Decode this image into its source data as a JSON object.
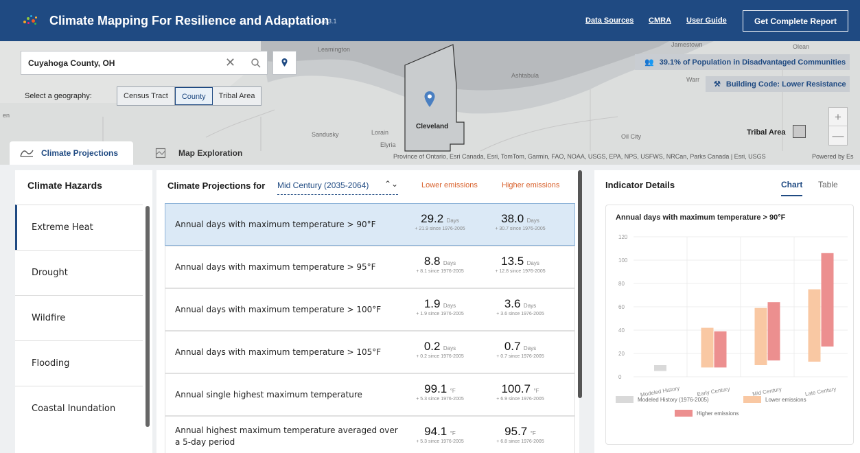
{
  "header": {
    "title": "Climate Mapping For Resilience and Adaptation",
    "version": "v1.3.1",
    "links": [
      "Data Sources",
      "CMRA",
      "User Guide"
    ],
    "report_button": "Get Complete Report",
    "brand_color": "#1f4a82"
  },
  "map": {
    "search_value": "Cuyahoga County, OH",
    "geography_label": "Select a geography:",
    "geography_options": [
      "Census Tract",
      "County",
      "Tribal Area"
    ],
    "geography_selected": "County",
    "population_badge": "39.1% of Population in Disadvantaged Communities",
    "building_code_badge": "Building Code: Lower Resistance",
    "places": {
      "leamington": "Leamington",
      "jamestown": "Jamestown",
      "olean": "Olean",
      "ashtabula": "Ashtabula",
      "warren": "Warr",
      "sandusky": "Sandusky",
      "lorain": "Lorain",
      "elyria": "Elyria",
      "cleveland": "Cleveland",
      "oil_city": "Oil City",
      "edge": "en"
    },
    "legend_label": "Tribal Area",
    "zoom_in": "+",
    "zoom_out": "—",
    "attribution": "Province of Ontario, Esri Canada, Esri, TomTom, Garmin, FAO, NOAA, USGS, EPA, NPS, USFWS, NRCan, Parks Canada | Esri, USGS",
    "powered_by": "Powered by Es"
  },
  "tabs": [
    "Climate Projections",
    "Map Exploration"
  ],
  "hazards": {
    "title": "Climate Hazards",
    "items": [
      "Extreme Heat",
      "Drought",
      "Wildfire",
      "Flooding",
      "Coastal Inundation"
    ],
    "selected": "Extreme Heat"
  },
  "projections": {
    "title": "Climate Projections for",
    "period": "Mid Century (2035-2064)",
    "caret": "⌃⌄",
    "lower_label": "Lower emissions",
    "higher_label": "Higher emissions",
    "rows": [
      {
        "label": "Annual days with maximum temperature > 90°F",
        "low": "29.2",
        "low_unit": "Days",
        "low_sub": "+ 21.9 since 1976-2005",
        "high": "38.0",
        "high_unit": "Days",
        "high_sub": "+ 30.7 since 1976-2005"
      },
      {
        "label": "Annual days with maximum temperature > 95°F",
        "low": "8.8",
        "low_unit": "Days",
        "low_sub": "+ 8.1 since 1976-2005",
        "high": "13.5",
        "high_unit": "Days",
        "high_sub": "+ 12.8 since 1976-2005"
      },
      {
        "label": "Annual days with maximum temperature > 100°F",
        "low": "1.9",
        "low_unit": "Days",
        "low_sub": "+ 1.9 since 1976-2005",
        "high": "3.6",
        "high_unit": "Days",
        "high_sub": "+ 3.6 since 1976-2005"
      },
      {
        "label": "Annual days with maximum temperature > 105°F",
        "low": "0.2",
        "low_unit": "Days",
        "low_sub": "+ 0.2 since 1976-2005",
        "high": "0.7",
        "high_unit": "Days",
        "high_sub": "+ 0.7 since 1976-2005"
      },
      {
        "label": "Annual single highest maximum temperature",
        "low": "99.1",
        "low_unit": "°F",
        "low_sub": "+ 5.3 since 1976-2005",
        "high": "100.7",
        "high_unit": "°F",
        "high_sub": "+ 6.9 since 1976-2005"
      },
      {
        "label": "Annual highest maximum temperature averaged over a 5-day period",
        "low": "94.1",
        "low_unit": "°F",
        "low_sub": "+ 5.3 since 1976-2005",
        "high": "95.7",
        "high_unit": "°F",
        "high_sub": "+ 6.8 since 1976-2005"
      }
    ]
  },
  "indicator": {
    "title": "Indicator Details",
    "tabs": [
      "Chart",
      "Table"
    ],
    "active_tab": "Chart"
  },
  "chart_data": {
    "type": "bar",
    "title": "Annual days with maximum temperature > 90°F",
    "categories": [
      "Modeled History",
      "Early Century",
      "Mid Century",
      "Late Century"
    ],
    "ylim": [
      0,
      120
    ],
    "yticks": [
      0,
      20,
      40,
      60,
      80,
      100,
      120
    ],
    "grid": true,
    "legend_position": "bottom",
    "series": [
      {
        "name": "Modeled History (1976-2005)",
        "color": "#d9d9d9",
        "ranges": [
          [
            5,
            10
          ],
          null,
          null,
          null
        ]
      },
      {
        "name": "Lower emissions",
        "color": "#f9c8a3",
        "ranges": [
          null,
          [
            8,
            42
          ],
          [
            10,
            59
          ],
          [
            13,
            75
          ]
        ]
      },
      {
        "name": "Higher emissions",
        "color": "#ec8f8f",
        "ranges": [
          null,
          [
            8,
            39
          ],
          [
            14,
            64
          ],
          [
            26,
            106
          ]
        ]
      }
    ]
  }
}
